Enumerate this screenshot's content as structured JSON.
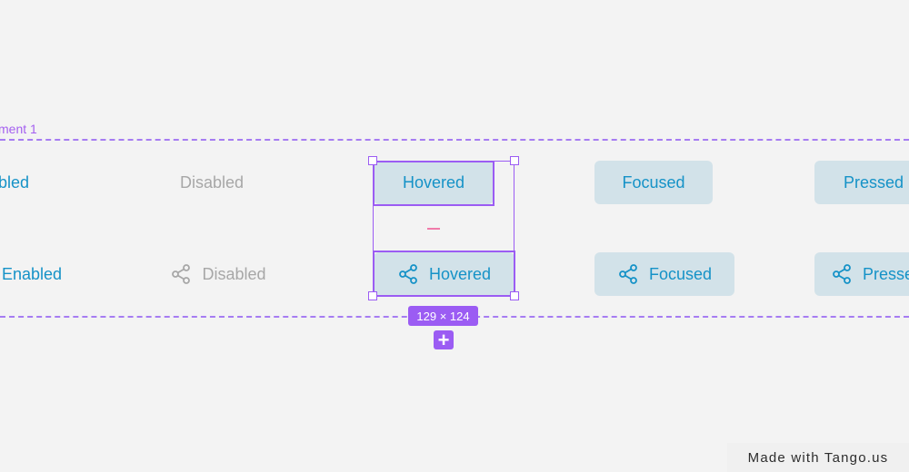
{
  "frame": {
    "label": "ment 1"
  },
  "row1": {
    "enabled": "abled",
    "disabled": "Disabled",
    "hovered": "Hovered",
    "focused": "Focused",
    "pressed": "Pressed"
  },
  "row2": {
    "enabled": "Enabled",
    "disabled": "Disabled",
    "hovered": "Hovered",
    "focused": "Focused",
    "pressed": "Presse"
  },
  "icons": {
    "button_icon": "share-icon",
    "add": "plus-icon"
  },
  "selection": {
    "dimensions": "129 × 124"
  },
  "watermark": {
    "text": "Made with Tango.us"
  },
  "colors": {
    "accent": "#1592c7",
    "disabled": "#a7a7a7",
    "selection": "#9b5cf3",
    "button_fill": "#d2e2e9",
    "background": "#f3f3f3"
  }
}
